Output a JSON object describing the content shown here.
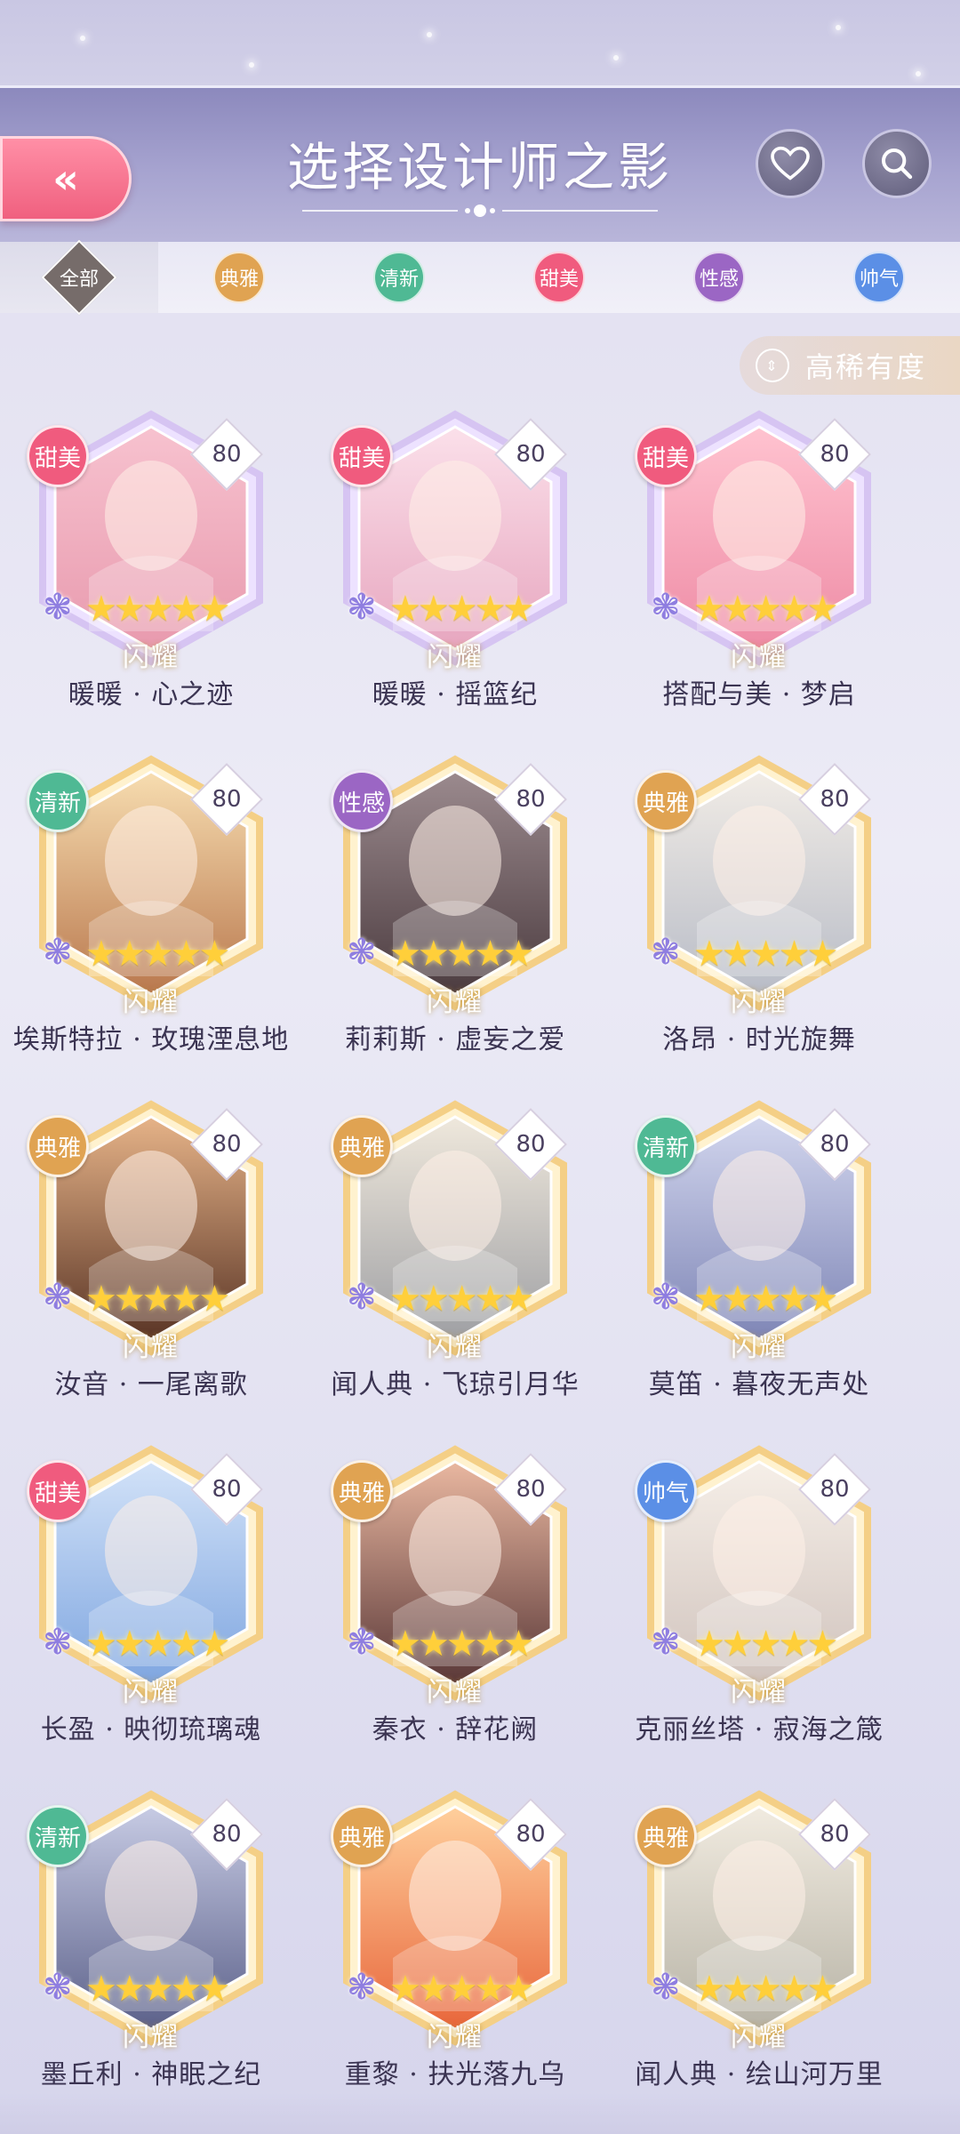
{
  "header": {
    "title": "选择设计师之影",
    "back_icon": "«"
  },
  "filters": [
    {
      "label": "全部",
      "color": "#766c6a",
      "active": true
    },
    {
      "label": "典雅",
      "color": "#e0a352"
    },
    {
      "label": "清新",
      "color": "#4fb994"
    },
    {
      "label": "甜美",
      "color": "#f05b7e"
    },
    {
      "label": "性感",
      "color": "#9b66c4"
    },
    {
      "label": "帅气",
      "color": "#5b8fe6"
    }
  ],
  "sort": {
    "label": "高稀有度"
  },
  "cards": [
    {
      "tag": "甜美",
      "tag_color": "#f05b7e",
      "level": "80",
      "name": "暖暖 · 心之迹",
      "theme": "purple",
      "portrait": [
        "#f7c2cf",
        "#e89aae"
      ]
    },
    {
      "tag": "甜美",
      "tag_color": "#f05b7e",
      "level": "80",
      "name": "暖暖 · 摇篮纪",
      "theme": "purple",
      "portrait": [
        "#fbe0ea",
        "#e7a6bf"
      ]
    },
    {
      "tag": "甜美",
      "tag_color": "#f05b7e",
      "level": "80",
      "name": "搭配与美 · 梦启",
      "theme": "purple",
      "portrait": [
        "#ffc3d0",
        "#ee8ba5"
      ]
    },
    {
      "tag": "清新",
      "tag_color": "#4fb994",
      "level": "80",
      "name": "埃斯特拉 · 玫瑰湮息地",
      "theme": "gold",
      "portrait": [
        "#f7ddb0",
        "#b9784e"
      ]
    },
    {
      "tag": "性感",
      "tag_color": "#9b66c4",
      "level": "80",
      "name": "莉莉斯 · 虚妄之爱",
      "theme": "gold",
      "portrait": [
        "#9b8a8e",
        "#4c3c40"
      ]
    },
    {
      "tag": "典雅",
      "tag_color": "#e0a352",
      "level": "80",
      "name": "洛昂 · 时光旋舞",
      "theme": "gold",
      "portrait": [
        "#f1ece6",
        "#b8bcc7"
      ]
    },
    {
      "tag": "典雅",
      "tag_color": "#e0a352",
      "level": "80",
      "name": "汝音 · 一尾离歌",
      "theme": "gold",
      "portrait": [
        "#e6b388",
        "#5a3526"
      ]
    },
    {
      "tag": "典雅",
      "tag_color": "#e0a352",
      "level": "80",
      "name": "闻人典 · 飞琼引月华",
      "theme": "gold",
      "portrait": [
        "#efe8dc",
        "#9fa0a4"
      ]
    },
    {
      "tag": "清新",
      "tag_color": "#4fb994",
      "level": "80",
      "name": "莫笛 · 暮夜无声处",
      "theme": "gold",
      "portrait": [
        "#d2d6ee",
        "#7f86b6"
      ]
    },
    {
      "tag": "甜美",
      "tag_color": "#f05b7e",
      "level": "80",
      "name": "长盈 · 映彻琉璃魂",
      "theme": "gold",
      "portrait": [
        "#d2e2f8",
        "#7fa6e0"
      ]
    },
    {
      "tag": "典雅",
      "tag_color": "#e0a352",
      "level": "80",
      "name": "秦衣 · 辞花阙",
      "theme": "gold",
      "portrait": [
        "#e9b7a0",
        "#5a3838"
      ]
    },
    {
      "tag": "帅气",
      "tag_color": "#5b8fe6",
      "level": "80",
      "name": "克丽丝塔 · 寂海之箴",
      "theme": "gold",
      "portrait": [
        "#f6efe8",
        "#d0c3bd"
      ]
    },
    {
      "tag": "清新",
      "tag_color": "#4fb994",
      "level": "80",
      "name": "墨丘利 · 神眠之纪",
      "theme": "gold",
      "portrait": [
        "#c7cbe4",
        "#5c618a"
      ]
    },
    {
      "tag": "典雅",
      "tag_color": "#e0a352",
      "level": "80",
      "name": "重黎 · 扶光落九乌",
      "theme": "gold",
      "portrait": [
        "#ffcf9c",
        "#e8663b"
      ]
    },
    {
      "tag": "典雅",
      "tag_color": "#e0a352",
      "level": "80",
      "name": "闻人典 · 绘山河万里",
      "theme": "gold",
      "portrait": [
        "#f1ebe0",
        "#b7b3a6"
      ]
    }
  ],
  "card_stars": "★★★★★",
  "card_flash_label": "闪耀",
  "card_flower_icon": "❃"
}
